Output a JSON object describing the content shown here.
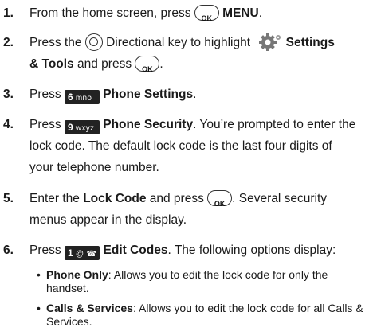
{
  "icons": {
    "ok_key": "ok-key-icon",
    "directional_key": "directional-key-icon",
    "settings_tools": "settings-tools-gear-icon",
    "key_6": "key-6-mno-icon",
    "key_9": "key-9-wxyz-icon",
    "key_1": "key-1-voicemail-icon"
  },
  "ok_key_label": "OK",
  "steps": [
    {
      "number": "1.",
      "text_a": "From the home screen, press",
      "menu_label": "MENU",
      "text_b": "."
    },
    {
      "number": "2.",
      "text_a": "Press the",
      "text_b": "Directional key to highlight",
      "bold_a": "Settings",
      "bold_b": "& Tools",
      "text_c": "and press",
      "text_d": "."
    },
    {
      "number": "3.",
      "text_a": "Press",
      "key_digit": "6",
      "key_letters": "mno",
      "bold": "Phone Settings",
      "text_b": "."
    },
    {
      "number": "4.",
      "text_a": "Press",
      "key_digit": "9",
      "key_letters": "wxyz",
      "bold": "Phone Security",
      "text_b": ". You’re prompted to enter the",
      "line2": "lock code. The default lock code is the last four digits of",
      "line3": "your telephone number."
    },
    {
      "number": "5.",
      "text_a": "Enter the",
      "bold": "Lock Code",
      "text_b": "and press",
      "text_c": ". Several security",
      "line2": "menus appear in the display."
    },
    {
      "number": "6.",
      "text_a": "Press",
      "key_digit": "1",
      "key_letters": "@ ☎",
      "bold": "Edit Codes",
      "text_b": ". The following options display:"
    }
  ],
  "options": [
    {
      "name": "Phone Only",
      "desc": ": Allows you to edit the lock code for only the handset."
    },
    {
      "name": "Calls & Services",
      "desc": ": Allows you to edit the lock code for all Calls &",
      "desc2": "Services."
    }
  ]
}
